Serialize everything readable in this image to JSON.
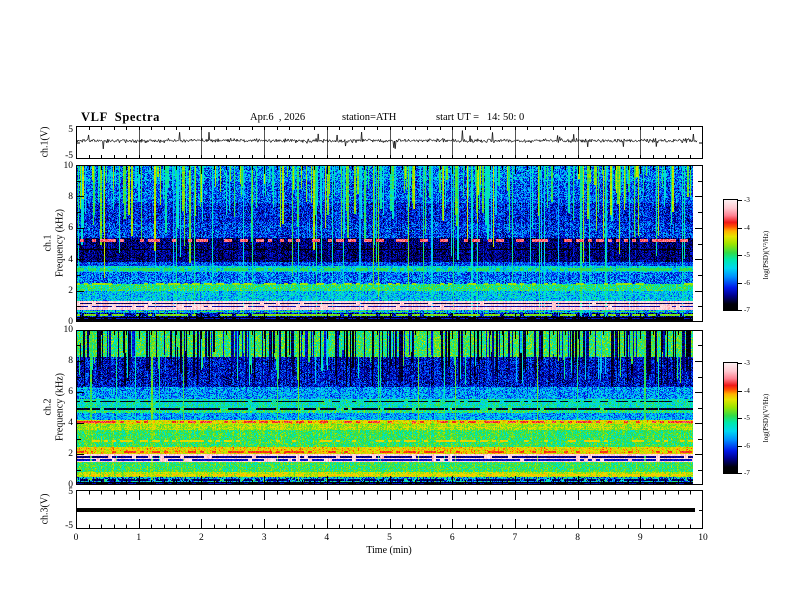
{
  "header": {
    "title": "VLF  Spectra",
    "date": "Apr.6  , 2026",
    "station": "station=ATH",
    "start_ut": "start UT =   14: 50: 0"
  },
  "axes": {
    "time_label": "Time  (min)",
    "time_ticks": [
      "0",
      "1",
      "2",
      "3",
      "4",
      "5",
      "6",
      "7",
      "8",
      "9",
      "10"
    ],
    "freq_ticks": [
      "10",
      "8",
      "6",
      "4",
      "2",
      "0"
    ],
    "volt_tick_top": "5",
    "volt_tick_bottom": "-5",
    "labels": {
      "ch1_wave": "ch.1(V)",
      "ch1_spec_ch": "ch.1",
      "ch1_spec_freq": "Frequency  (kHz)",
      "ch2_spec_ch": "ch.2",
      "ch2_spec_freq": "Frequency  (kHz)",
      "ch3_wave": "ch.3(V)"
    },
    "colorbar": {
      "label": "log(PSD)(V²/Hz)",
      "ticks": [
        "-3",
        "-4",
        "-5",
        "-6",
        "-7"
      ]
    }
  },
  "chart_data": [
    {
      "panel": "ch1_waveform",
      "type": "line",
      "ylabel": "ch.1(V)",
      "ylim": [
        -5,
        5
      ],
      "xlim_min": [
        0,
        10
      ],
      "data_end_min": 9.9,
      "series_desc": "continuous broadband noise trace centered near +0.5 V with impulsive spikes to about ±3 V",
      "mean_v": 0.55,
      "noise_v": 0.5,
      "spike_prob": 0.022,
      "spike_max_v": 3.2
    },
    {
      "panel": "ch1_spectrogram",
      "type": "heatmap",
      "ylabel": "ch.1 Frequency (kHz)",
      "xlabel": "Time (min)",
      "xlim": [
        0,
        10
      ],
      "ylim": [
        0,
        10
      ],
      "clim": [
        -7,
        -3
      ],
      "colorbar_label": "log(PSD)(V²/Hz)",
      "data_end_min": 9.84,
      "bands_format": [
        "f_low_kHz",
        "f_high_kHz",
        "level_logPSD",
        "noise"
      ],
      "bands": [
        [
          9.0,
          10.0,
          -5.85,
          0.55
        ],
        [
          7.6,
          9.0,
          -6.0,
          0.5
        ],
        [
          6.3,
          7.6,
          -6.2,
          0.45
        ],
        [
          5.35,
          6.3,
          -6.1,
          0.5
        ],
        [
          3.85,
          5.35,
          -6.55,
          0.35
        ],
        [
          3.55,
          3.85,
          -6.05,
          0.4
        ],
        [
          3.2,
          3.55,
          -5.4,
          0.45
        ],
        [
          2.45,
          3.2,
          -5.9,
          0.5
        ],
        [
          1.95,
          2.45,
          -5.05,
          0.4
        ],
        [
          1.35,
          1.95,
          -5.55,
          0.5
        ],
        [
          0.78,
          1.35,
          -3.2,
          0.12
        ],
        [
          0.55,
          0.78,
          -5.7,
          0.6
        ],
        [
          0.3,
          0.55,
          -6.4,
          0.5
        ],
        [
          0.0,
          0.3,
          -6.95,
          0.1
        ]
      ],
      "lines_format": [
        "f_kHz",
        "halfwidth_kHz",
        "level_logPSD",
        "dash_on_prob"
      ],
      "lines": [
        [
          5.2,
          0.08,
          -3.6,
          0.5
        ],
        [
          4.62,
          0.06,
          -6.9,
          0.8
        ],
        [
          3.35,
          0.07,
          -4.95,
          0.55
        ],
        [
          2.42,
          0.05,
          -4.6,
          0.45
        ],
        [
          1.16,
          0.04,
          -6.6,
          0.9
        ],
        [
          0.98,
          0.04,
          -6.4,
          0.85
        ],
        [
          0.68,
          0.05,
          -4.9,
          0.6
        ],
        [
          0.45,
          0.05,
          -4.7,
          0.7
        ],
        [
          0.2,
          0.04,
          -6.3,
          0.6
        ]
      ],
      "streaks": [
        {
          "count": 240,
          "level": -5.0,
          "spread": 0.55,
          "blend": "max",
          "ranges": [
            [
              6.8,
              9.4,
              0.7
            ],
            [
              4.0,
              6.8,
              0.94
            ],
            [
              1.5,
              4.0,
              1.0
            ]
          ]
        },
        {
          "count": 26,
          "level": -5.35,
          "spread": 0.3,
          "blend": "max",
          "ranges": [
            [
              0.35,
              0.45,
              1.0
            ]
          ]
        }
      ]
    },
    {
      "panel": "ch2_spectrogram",
      "type": "heatmap",
      "ylabel": "ch.2 Frequency (kHz)",
      "xlabel": "Time (min)",
      "xlim": [
        0,
        10
      ],
      "ylim": [
        0,
        10
      ],
      "clim": [
        -7,
        -3
      ],
      "colorbar_label": "log(PSD)(V²/Hz)",
      "data_end_min": 9.84,
      "bands_format": [
        "f_low_kHz",
        "f_high_kHz",
        "level_logPSD",
        "noise"
      ],
      "bands": [
        [
          8.25,
          10.0,
          -4.95,
          0.45
        ],
        [
          6.3,
          8.25,
          -6.3,
          0.45
        ],
        [
          5.55,
          6.3,
          -5.75,
          0.5
        ],
        [
          5.0,
          5.55,
          -5.25,
          0.4
        ],
        [
          4.65,
          5.0,
          -5.05,
          0.4
        ],
        [
          4.2,
          4.65,
          -5.7,
          0.45
        ],
        [
          3.95,
          4.2,
          -4.35,
          0.3
        ],
        [
          3.55,
          3.95,
          -4.6,
          0.3
        ],
        [
          2.45,
          3.55,
          -4.95,
          0.35
        ],
        [
          2.0,
          2.45,
          -4.3,
          0.3
        ],
        [
          1.5,
          2.0,
          -3.2,
          0.12
        ],
        [
          0.85,
          1.5,
          -4.95,
          0.35
        ],
        [
          0.5,
          0.85,
          -4.5,
          0.3
        ],
        [
          0.2,
          0.5,
          -5.7,
          0.9
        ],
        [
          0.0,
          0.2,
          -6.9,
          0.15
        ]
      ],
      "lines_format": [
        "f_kHz",
        "halfwidth_kHz",
        "level_logPSD",
        "dash_on_prob"
      ],
      "lines": [
        [
          5.38,
          0.05,
          -6.8,
          0.7
        ],
        [
          4.9,
          0.06,
          -6.75,
          0.8
        ],
        [
          4.05,
          0.07,
          -3.75,
          0.5
        ],
        [
          3.7,
          0.05,
          -4.3,
          0.4
        ],
        [
          2.85,
          0.05,
          -4.3,
          0.5
        ],
        [
          2.15,
          0.06,
          -3.85,
          0.45
        ],
        [
          1.8,
          0.04,
          -6.5,
          0.9
        ],
        [
          1.62,
          0.04,
          -6.3,
          0.85
        ],
        [
          0.65,
          0.05,
          -4.25,
          0.55
        ],
        [
          0.32,
          0.04,
          -6.6,
          0.7
        ],
        [
          0.08,
          0.05,
          -6.4,
          0.5
        ]
      ],
      "streaks": [
        {
          "count": 260,
          "level": -6.55,
          "spread": 0.35,
          "blend": "min",
          "ranges": [
            [
              6.35,
              8.6,
              1.0
            ]
          ]
        },
        {
          "count": 70,
          "level": -5.2,
          "spread": 0.45,
          "blend": "max",
          "ranges": [
            [
              6.5,
              9.3,
              1.0
            ]
          ]
        },
        {
          "count": 18,
          "level": -5.05,
          "spread": 0.3,
          "blend": "max",
          "ranges": [
            [
              0.3,
              0.4,
              1.0
            ]
          ]
        }
      ]
    },
    {
      "panel": "ch3_waveform",
      "type": "line",
      "ylabel": "ch.3(V)",
      "ylim": [
        -5,
        5
      ],
      "xlim_min": [
        0,
        10
      ],
      "data_end_min": 9.87,
      "value": 0.0,
      "series_desc": "flat thick black line at 0 V for the whole record"
    }
  ],
  "render": {
    "seed": 1337,
    "colormap": [
      [
        0.0,
        "#000000"
      ],
      [
        0.05,
        "#00000a"
      ],
      [
        0.13,
        "#000090"
      ],
      [
        0.2,
        "#0018e8"
      ],
      [
        0.3,
        "#0090ff"
      ],
      [
        0.38,
        "#00d8f0"
      ],
      [
        0.46,
        "#00e8a8"
      ],
      [
        0.52,
        "#30dc48"
      ],
      [
        0.6,
        "#9ce400"
      ],
      [
        0.67,
        "#e6e300"
      ],
      [
        0.72,
        "#ffb000"
      ],
      [
        0.76,
        "#ff5000"
      ],
      [
        0.8,
        "#f01818"
      ],
      [
        0.86,
        "#ff8090"
      ],
      [
        0.93,
        "#ffc8d0"
      ],
      [
        1.0,
        "#fdeef0"
      ]
    ]
  }
}
